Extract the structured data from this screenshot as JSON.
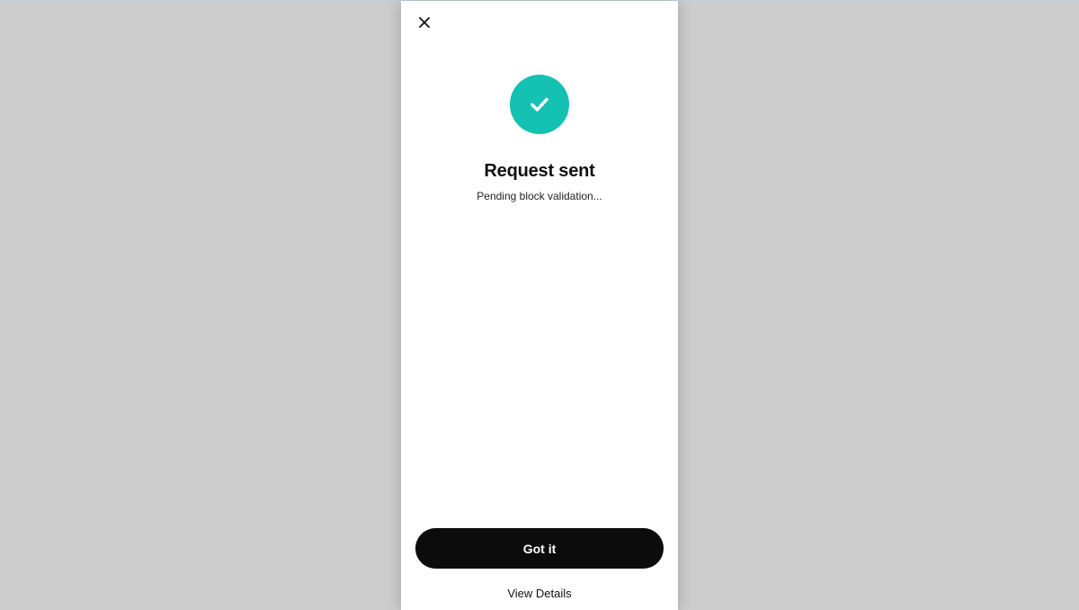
{
  "colors": {
    "page_background": "#cdcdcd",
    "panel_background": "#ffffff",
    "success_accent": "#14c1b3",
    "primary_button": "#0c0c0c",
    "text": "#111111"
  },
  "icons": {
    "close": "close-icon",
    "success": "check-icon"
  },
  "status": {
    "title": "Request sent",
    "subtitle": "Pending block validation..."
  },
  "actions": {
    "primary_label": "Got it",
    "secondary_label": "View Details"
  }
}
